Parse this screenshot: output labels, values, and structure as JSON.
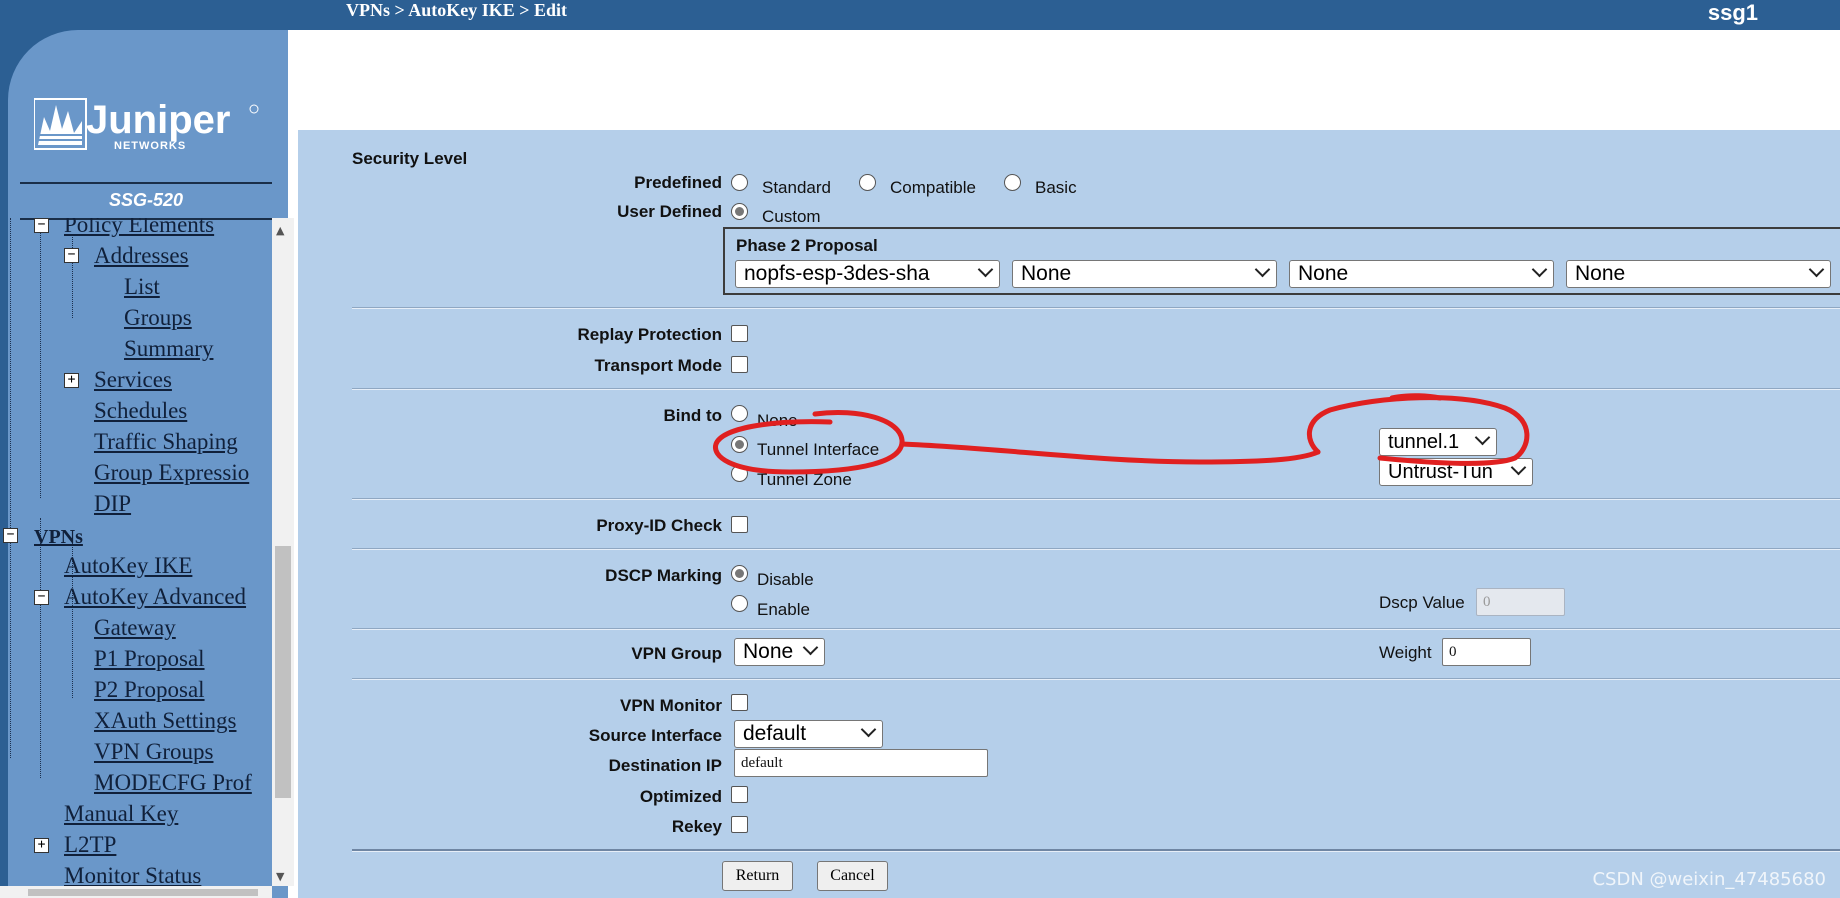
{
  "header": {
    "breadcrumb": "VPNs > AutoKey IKE > Edit",
    "device_name": "ssg1"
  },
  "sidebar": {
    "logo_text": "Juniper",
    "logo_subtext": "NETWORKS",
    "model": "SSG-520",
    "nav": {
      "policy_elements": "Policy Elements",
      "addresses": "Addresses",
      "list": "List",
      "groups": "Groups",
      "summary": "Summary",
      "services": "Services",
      "schedules": "Schedules",
      "traffic_shaping": "Traffic Shaping",
      "group_expressions": "Group Expressio",
      "dip": "DIP",
      "vpns": "VPNs",
      "autokey_ike": "AutoKey IKE",
      "autokey_advanced": "AutoKey Advanced",
      "gateway": "Gateway",
      "p1_proposal": "P1 Proposal",
      "p2_proposal": "P2 Proposal",
      "xauth_settings": "XAuth Settings",
      "vpn_groups": "VPN Groups",
      "modecfg": "MODECFG Prof",
      "manual_key": "Manual Key",
      "l2tp": "L2TP",
      "monitor_status": "Monitor Status"
    }
  },
  "form": {
    "security_level_title": "Security Level",
    "predefined_label": "Predefined",
    "predefined_options": [
      "Standard",
      "Compatible",
      "Basic"
    ],
    "user_defined_label": "User Defined",
    "custom_label": "Custom",
    "phase2_title": "Phase 2 Proposal",
    "phase2_selects": [
      "nopfs-esp-3des-sha",
      "None",
      "None",
      "None"
    ],
    "replay_protection_label": "Replay Protection",
    "transport_mode_label": "Transport Mode",
    "bind_to_label": "Bind to",
    "bind_to_options": [
      "None",
      "Tunnel Interface",
      "Tunnel Zone"
    ],
    "bind_to_selected": "Tunnel Interface",
    "tunnel_interface_value": "tunnel.1",
    "tunnel_zone_value": "Untrust-Tun",
    "proxy_id_label": "Proxy-ID Check",
    "dscp_label": "DSCP Marking",
    "dscp_options": [
      "Disable",
      "Enable"
    ],
    "dscp_selected": "Disable",
    "dscp_value_label": "Dscp Value",
    "dscp_value": "0",
    "vpn_group_label": "VPN Group",
    "vpn_group_value": "None",
    "weight_label": "Weight",
    "weight_value": "0",
    "vpn_monitor_label": "VPN Monitor",
    "source_interface_label": "Source Interface",
    "source_interface_value": "default",
    "destination_ip_label": "Destination IP",
    "destination_ip_value": "default",
    "optimized_label": "Optimized",
    "rekey_label": "Rekey",
    "return_button": "Return",
    "cancel_button": "Cancel"
  },
  "watermark": "CSDN @weixin_47485680",
  "colors": {
    "header_bg": "#2c5f93",
    "sidebar_bg": "#6a97c9",
    "content_bg": "#b5cfea",
    "annotation_red": "#e02020"
  }
}
